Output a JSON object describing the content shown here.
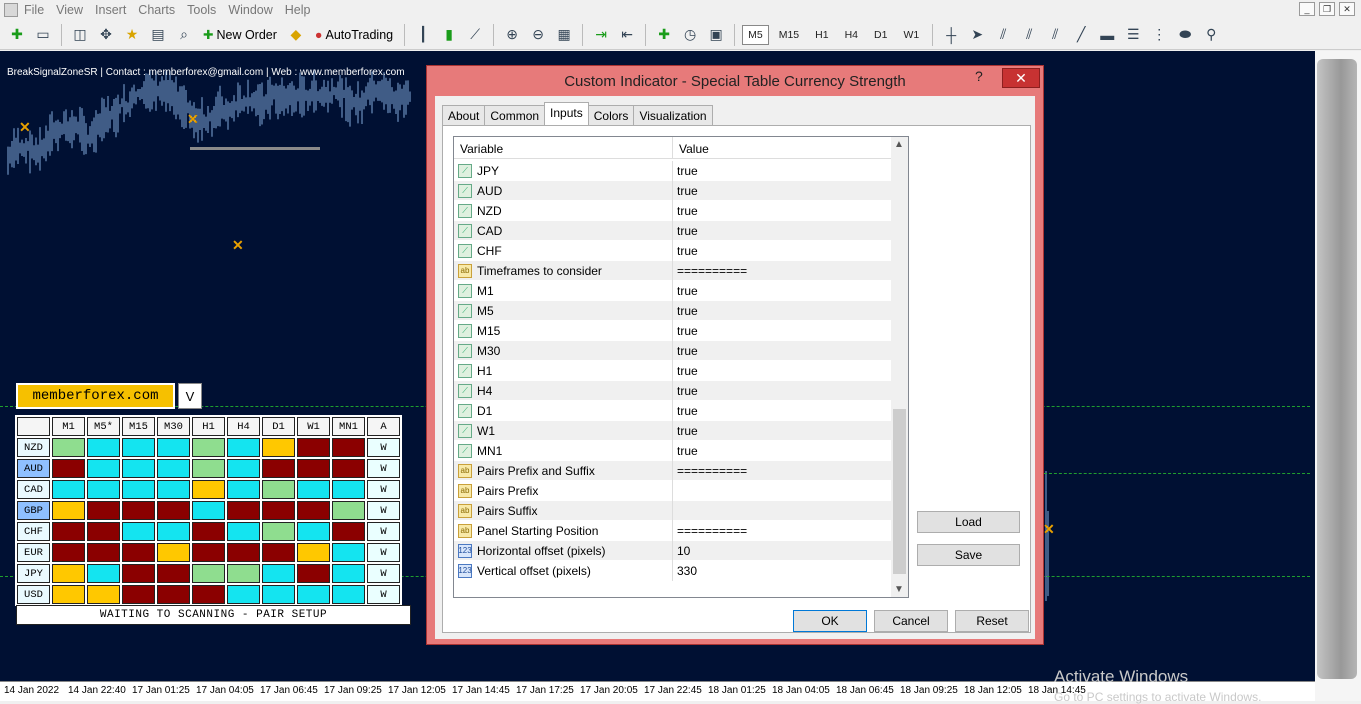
{
  "menu": {
    "items": [
      "File",
      "View",
      "Insert",
      "Charts",
      "Tools",
      "Window",
      "Help"
    ]
  },
  "window_controls": {
    "min": "_",
    "max": "❐",
    "close": "✕"
  },
  "toolbar": {
    "new_order": "New Order",
    "autotrading": "AutoTrading",
    "timeframes": [
      "M5",
      "M15",
      "H1",
      "H4",
      "D1",
      "W1"
    ],
    "active_timeframe": "M5"
  },
  "chart": {
    "title": "BreakSignalZoneSR | Contact : memberforex@gmail.com | Web : www.memberforex.com",
    "x_labels": [
      "14 Jan 2022",
      "14 Jan 22:40",
      "17 Jan 01:25",
      "17 Jan 04:05",
      "17 Jan 06:45",
      "17 Jan 09:25",
      "17 Jan 12:05",
      "17 Jan 14:45",
      "17 Jan 17:25",
      "17 Jan 20:05",
      "17 Jan 22:45",
      "18 Jan 01:25",
      "18 Jan 04:05",
      "18 Jan 06:45",
      "18 Jan 09:25",
      "18 Jan 12:05",
      "18 Jan 14:45"
    ]
  },
  "panel": {
    "brand": "memberforex.com",
    "v_button": "V",
    "columns": [
      "",
      "M1",
      "M5*",
      "M15",
      "M30",
      "H1",
      "H4",
      "D1",
      "W1",
      "MN1",
      "A"
    ],
    "rows": [
      {
        "cur": "NZD",
        "hl": false,
        "cells": [
          "g",
          "c",
          "c",
          "c",
          "g",
          "c",
          "y",
          "r",
          "r"
        ],
        "a": "W"
      },
      {
        "cur": "AUD",
        "hl": true,
        "cells": [
          "r",
          "c",
          "c",
          "c",
          "g",
          "c",
          "r",
          "r",
          "r"
        ],
        "a": "W"
      },
      {
        "cur": "CAD",
        "hl": false,
        "cells": [
          "c",
          "c",
          "c",
          "c",
          "y",
          "c",
          "g",
          "c",
          "c"
        ],
        "a": "W"
      },
      {
        "cur": "GBP",
        "hl": true,
        "cells": [
          "y",
          "r",
          "r",
          "r",
          "c",
          "r",
          "r",
          "r",
          "g"
        ],
        "a": "W"
      },
      {
        "cur": "CHF",
        "hl": false,
        "cells": [
          "r",
          "r",
          "c",
          "c",
          "r",
          "c",
          "g",
          "c",
          "r"
        ],
        "a": "W"
      },
      {
        "cur": "EUR",
        "hl": false,
        "cells": [
          "r",
          "r",
          "r",
          "y",
          "r",
          "r",
          "r",
          "y",
          "c"
        ],
        "a": "W"
      },
      {
        "cur": "JPY",
        "hl": false,
        "cells": [
          "y",
          "c",
          "r",
          "r",
          "g",
          "g",
          "c",
          "r",
          "c"
        ],
        "a": "W"
      },
      {
        "cur": "USD",
        "hl": false,
        "cells": [
          "y",
          "y",
          "r",
          "r",
          "r",
          "c",
          "c",
          "c",
          "c"
        ],
        "a": "W"
      }
    ],
    "status": "WAITING TO SCANNING - PAIR SETUP"
  },
  "dialog": {
    "title": "Custom Indicator - Special Table Currency Strength",
    "help": "?",
    "close": "✕",
    "tabs": [
      "About",
      "Common",
      "Inputs",
      "Colors",
      "Visualization"
    ],
    "active_tab": "Inputs",
    "col_variable": "Variable",
    "col_value": "Value",
    "params": [
      {
        "type": "bool",
        "name": "JPY",
        "value": "true"
      },
      {
        "type": "bool",
        "name": "AUD",
        "value": "true"
      },
      {
        "type": "bool",
        "name": "NZD",
        "value": "true"
      },
      {
        "type": "bool",
        "name": "CAD",
        "value": "true"
      },
      {
        "type": "bool",
        "name": "CHF",
        "value": "true"
      },
      {
        "type": "str",
        "name": "Timeframes to consider",
        "value": "=========="
      },
      {
        "type": "bool",
        "name": "M1",
        "value": "true"
      },
      {
        "type": "bool",
        "name": "M5",
        "value": "true"
      },
      {
        "type": "bool",
        "name": "M15",
        "value": "true"
      },
      {
        "type": "bool",
        "name": "M30",
        "value": "true"
      },
      {
        "type": "bool",
        "name": "H1",
        "value": "true"
      },
      {
        "type": "bool",
        "name": "H4",
        "value": "true"
      },
      {
        "type": "bool",
        "name": "D1",
        "value": "true"
      },
      {
        "type": "bool",
        "name": "W1",
        "value": "true"
      },
      {
        "type": "bool",
        "name": "MN1",
        "value": "true"
      },
      {
        "type": "str",
        "name": "Pairs Prefix and Suffix",
        "value": "=========="
      },
      {
        "type": "str",
        "name": "Pairs Prefix",
        "value": ""
      },
      {
        "type": "str",
        "name": "Pairs Suffix",
        "value": ""
      },
      {
        "type": "str",
        "name": "Panel Starting Position",
        "value": "=========="
      },
      {
        "type": "num",
        "name": "Horizontal offset (pixels)",
        "value": "10"
      },
      {
        "type": "num",
        "name": "Vertical offset (pixels)",
        "value": "330"
      }
    ],
    "load": "Load",
    "save": "Save",
    "ok": "OK",
    "cancel": "Cancel",
    "reset": "Reset"
  },
  "watermark": {
    "line1": "Activate Windows",
    "line2": "Go to PC settings to activate Windows."
  }
}
